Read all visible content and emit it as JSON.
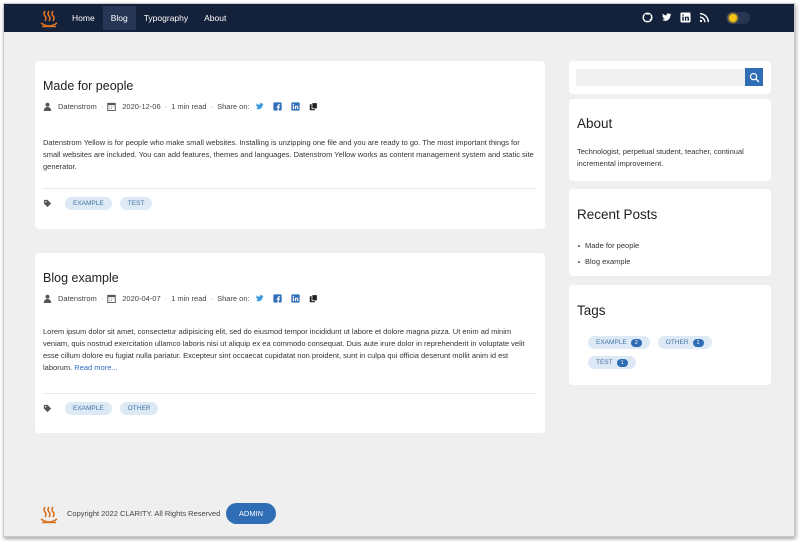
{
  "nav": {
    "items": [
      {
        "label": "Home",
        "active": false
      },
      {
        "label": "Blog",
        "active": true
      },
      {
        "label": "Typography",
        "active": false
      },
      {
        "label": "About",
        "active": false
      }
    ],
    "social_icons": [
      "github-icon",
      "twitter-icon",
      "linkedin-icon",
      "rss-icon"
    ],
    "theme_toggle_icon": "sun-icon"
  },
  "colors": {
    "topbar": "#14213b",
    "accent": "#2f6db4",
    "pill_bg": "#dde9f4",
    "pill_text": "#3f73a7",
    "logo": "#d9731f"
  },
  "posts": [
    {
      "title": "Made for people",
      "author": "Datenstrom",
      "date": "2020-12-06",
      "read_time": "1 min read",
      "share_label": "Share on:",
      "body": "Datenstrom Yellow is for people who make small websites. Installing is unzipping one file and you are ready to go. The most important things for small websites are included. You can add features, themes and languages. Datenstrom Yellow works as content management system and static site generator.",
      "read_more": "",
      "tags": [
        "EXAMPLE",
        "TEST"
      ]
    },
    {
      "title": "Blog example",
      "author": "Datenstrom",
      "date": "2020-04-07",
      "read_time": "1 min read",
      "share_label": "Share on:",
      "body": "Lorem ipsum dolor sit amet, consectetur adipisicing elit, sed do eiusmod tempor incididunt ut labore et dolore magna pizza. Ut enim ad minim veniam, quis nostrud exercitation ullamco laboris nisi ut aliquip ex ea commodo consequat. Duis aute irure dolor in reprehenderit in voluptate velit esse cillum dolore eu fugiat nulla pariatur. Excepteur sint occaecat cupidatat non proident, sunt in culpa qui officia deserunt mollit anim id est laborum.",
      "read_more": "Read more...",
      "tags": [
        "EXAMPLE",
        "OTHER"
      ]
    }
  ],
  "sidebar": {
    "search": {
      "placeholder": "",
      "value": ""
    },
    "about": {
      "title": "About",
      "text": "Technologist, perpetual student, teacher, continual incremental improvement."
    },
    "recent": {
      "title": "Recent Posts",
      "items": [
        "Made for people",
        "Blog example"
      ]
    },
    "tags": {
      "title": "Tags",
      "items": [
        {
          "label": "EXAMPLE",
          "count": "2"
        },
        {
          "label": "OTHER",
          "count": "1"
        },
        {
          "label": "TEST",
          "count": "1"
        }
      ]
    }
  },
  "footer": {
    "copyright": "Copyright 2022 CLARITY. All Rights Reserved",
    "admin_label": "ADMIN"
  }
}
